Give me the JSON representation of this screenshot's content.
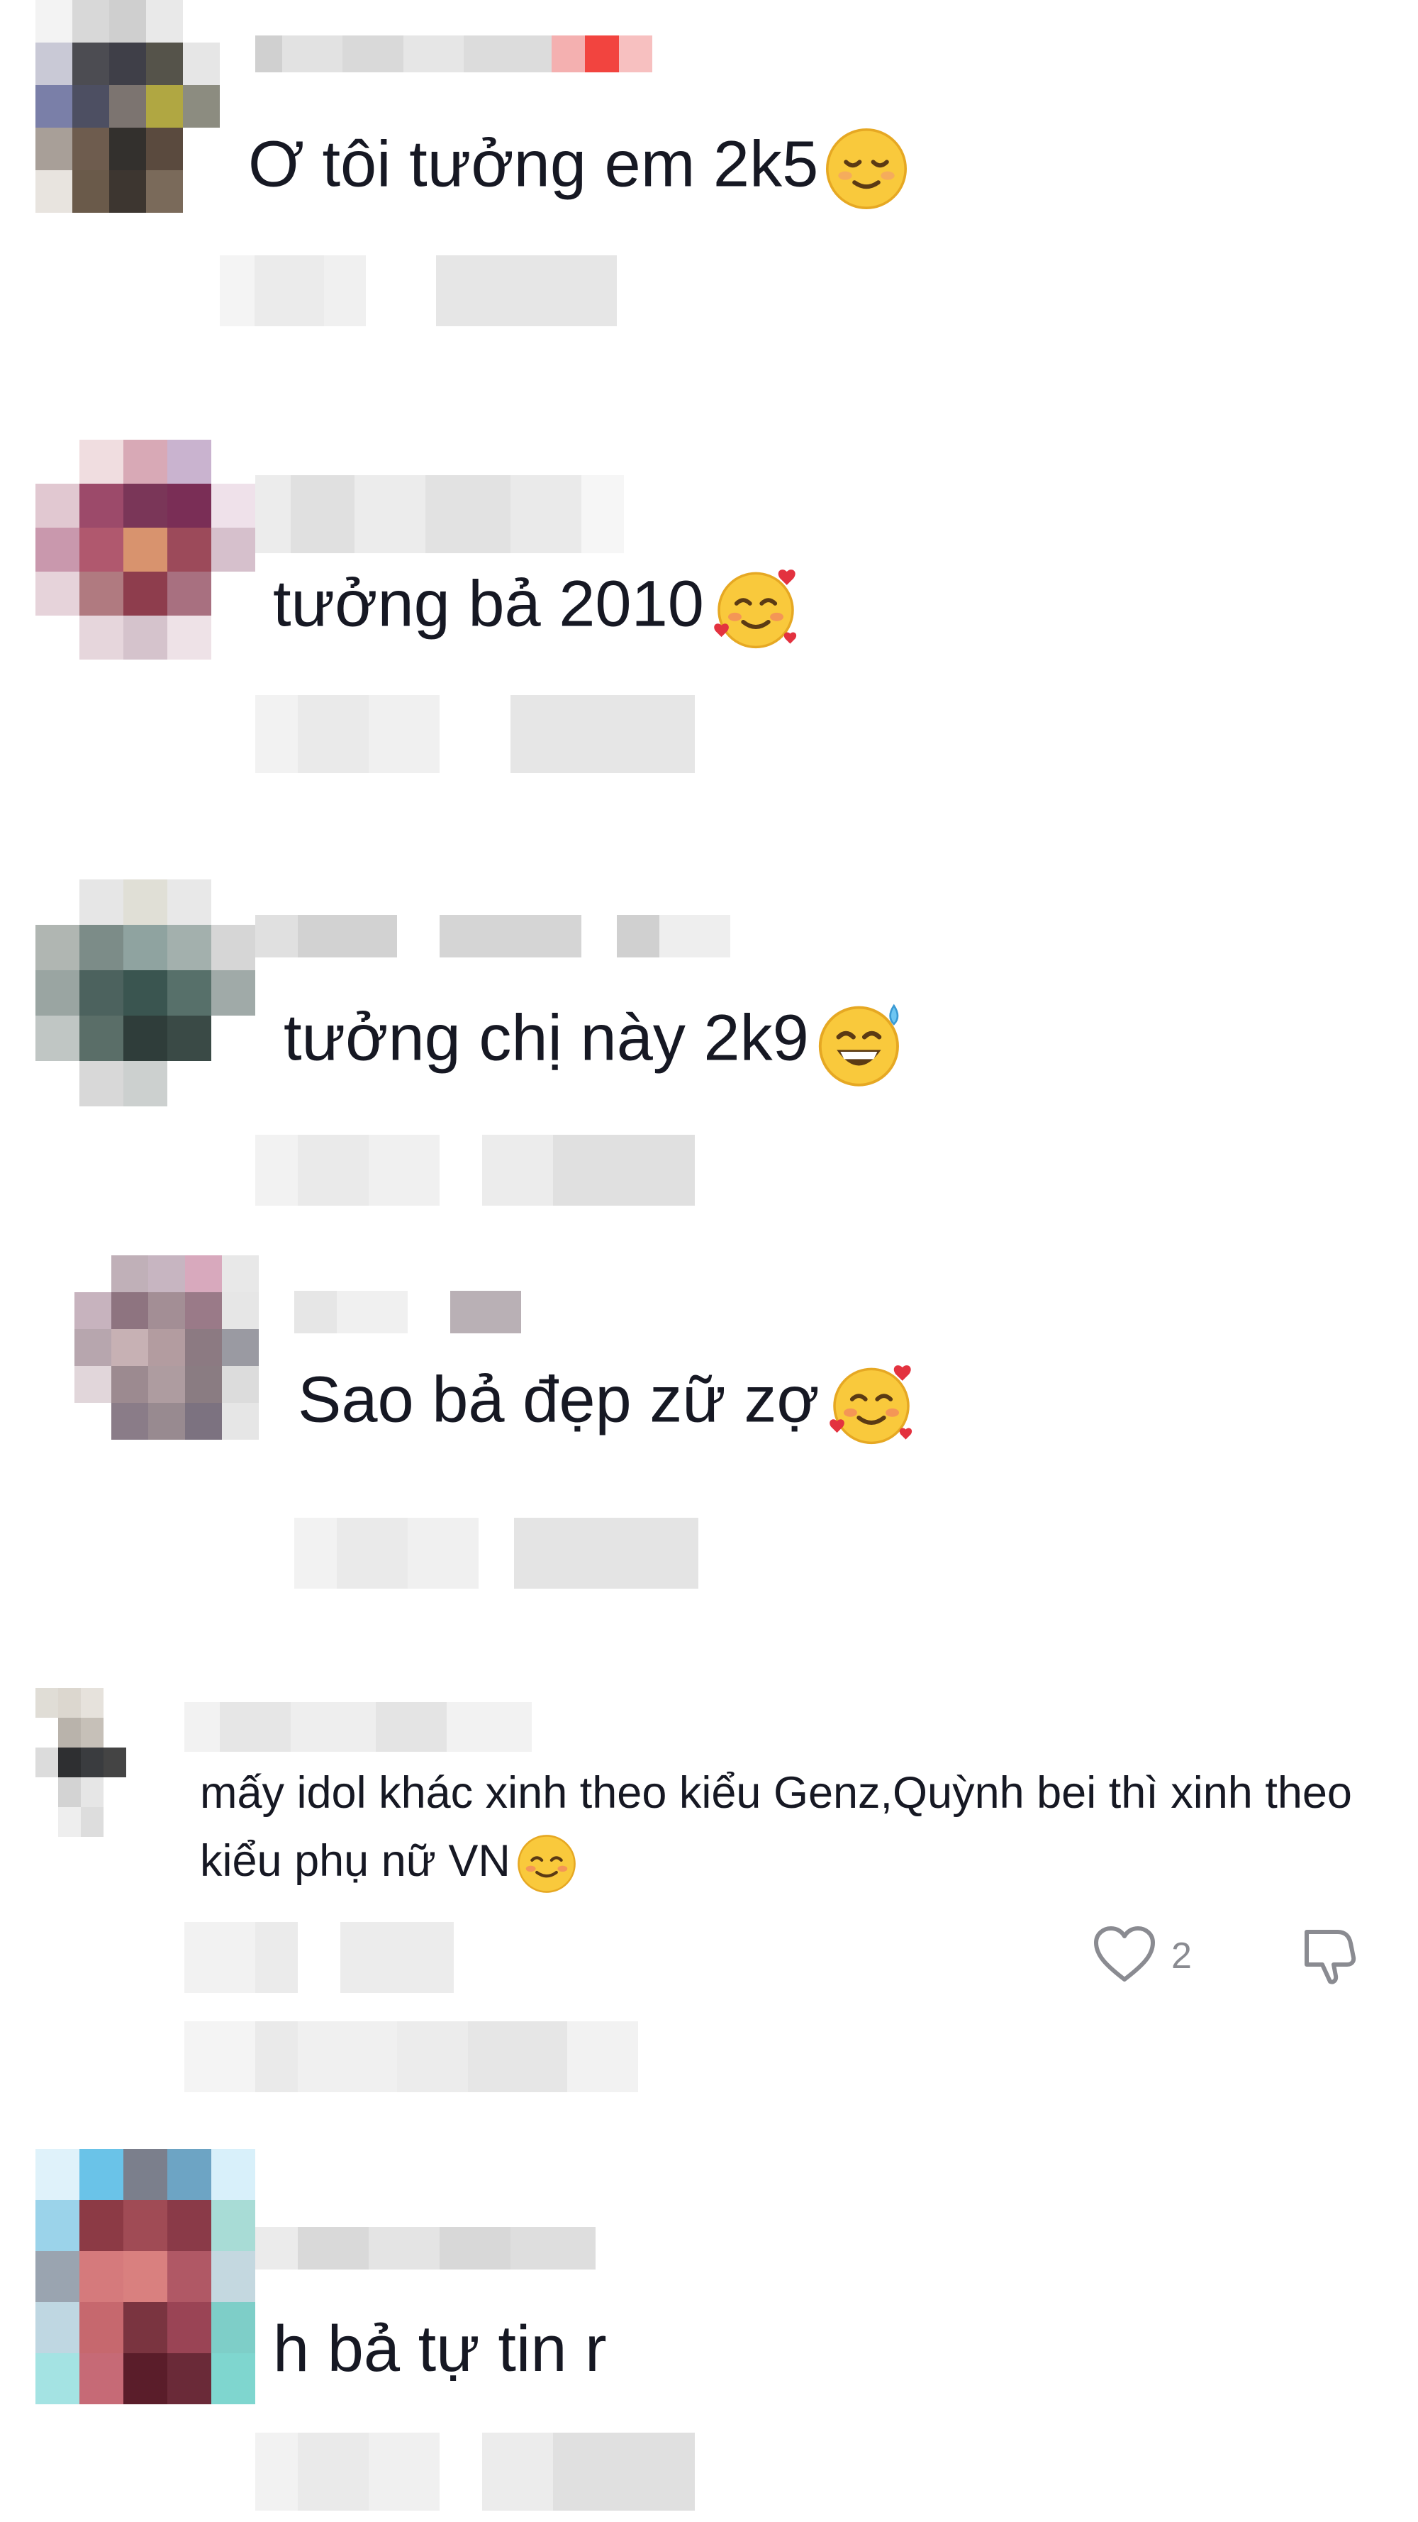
{
  "comments": [
    {
      "text": "Ơ tôi tưởng em 2k5",
      "emoji": "relieved-face"
    },
    {
      "text": "tưởng bả 2010",
      "emoji": "smiling-face-with-hearts"
    },
    {
      "text": "tưởng chị này 2k9",
      "emoji": "grinning-face-with-sweat"
    },
    {
      "text": "Sao bả đẹp zữ zợ",
      "emoji": "smiling-face-with-hearts"
    },
    {
      "text": "mấy idol khác xinh theo kiểu Genz,Quỳnh bei thì xinh theo kiểu phụ nữ VN",
      "emoji": "smiling-face",
      "like_count": "2"
    },
    {
      "text": "h bả tự tin r"
    }
  ],
  "colors": {
    "text": "#161823",
    "muted": "#8a8b91",
    "blur": "#e6e6e6"
  }
}
